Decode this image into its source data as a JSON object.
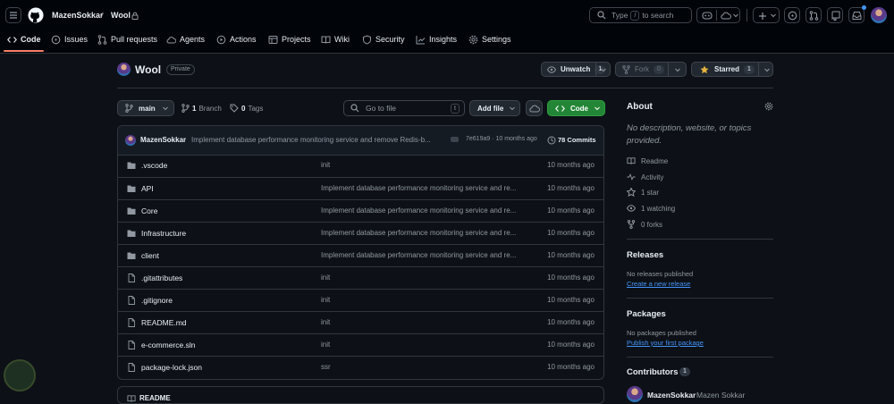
{
  "header": {
    "owner": "MazenSokkar",
    "separator": "/",
    "repo": "Wool",
    "search_placeholder_pre": "Type",
    "search_key": "/",
    "search_placeholder_post": "to search"
  },
  "nav": {
    "items": [
      {
        "label": "Code",
        "icon": "code-icon"
      },
      {
        "label": "Issues",
        "icon": "issue-icon"
      },
      {
        "label": "Pull requests",
        "icon": "pull-request-icon"
      },
      {
        "label": "Agents",
        "icon": "agents-icon"
      },
      {
        "label": "Actions",
        "icon": "play-icon"
      },
      {
        "label": "Projects",
        "icon": "table-icon"
      },
      {
        "label": "Wiki",
        "icon": "book-icon"
      },
      {
        "label": "Security",
        "icon": "shield-icon"
      },
      {
        "label": "Insights",
        "icon": "graph-icon"
      },
      {
        "label": "Settings",
        "icon": "gear-icon"
      }
    ]
  },
  "repo": {
    "name": "Wool",
    "visibility": "Private",
    "unwatch_label": "Unwatch",
    "unwatch_count": "1",
    "fork_label": "Fork",
    "fork_count": "0",
    "starred_label": "Starred",
    "star_count": "1"
  },
  "toolbar": {
    "branch": "main",
    "branch_count": "1",
    "branch_label": "Branch",
    "tag_count": "0",
    "tag_label": "Tags",
    "goto_placeholder": "Go to file",
    "goto_key": "t",
    "add_file": "Add file",
    "code_button": "Code"
  },
  "commit": {
    "author": "MazenSokkar",
    "message": "Implement database performance monitoring service and remove Redis-b...",
    "hash_time": "7e619a9 · 10 months ago",
    "commits": "78 Commits"
  },
  "files": [
    {
      "type": "folder",
      "name": ".vscode",
      "message": "init",
      "time": "10 months ago"
    },
    {
      "type": "folder",
      "name": "API",
      "message": "Implement database performance monitoring service and re...",
      "time": "10 months ago"
    },
    {
      "type": "folder",
      "name": "Core",
      "message": "Implement database performance monitoring service and re...",
      "time": "10 months ago"
    },
    {
      "type": "folder",
      "name": "Infrastructure",
      "message": "Implement database performance monitoring service and re...",
      "time": "10 months ago"
    },
    {
      "type": "folder",
      "name": "client",
      "message": "Implement database performance monitoring service and re...",
      "time": "10 months ago"
    },
    {
      "type": "file",
      "name": ".gitattributes",
      "message": "init",
      "time": "10 months ago"
    },
    {
      "type": "file",
      "name": ".gitignore",
      "message": "init",
      "time": "10 months ago"
    },
    {
      "type": "file",
      "name": "README.md",
      "message": "init",
      "time": "10 months ago"
    },
    {
      "type": "file",
      "name": "e-commerce.sln",
      "message": "init",
      "time": "10 months ago"
    },
    {
      "type": "file",
      "name": "package-lock.json",
      "message": "ssr",
      "time": "10 months ago"
    }
  ],
  "readme_tab": "README",
  "about": {
    "title": "About",
    "description": "No description, website, or topics provided.",
    "items": [
      {
        "icon": "book-icon",
        "label": "Readme"
      },
      {
        "icon": "pulse-icon",
        "label": "Activity"
      },
      {
        "icon": "star-icon",
        "label": "1 star"
      },
      {
        "icon": "eye-icon",
        "label": "1 watching"
      },
      {
        "icon": "fork-icon",
        "label": "0 forks"
      }
    ]
  },
  "releases": {
    "title": "Releases",
    "empty": "No releases published",
    "link": "Create a new release"
  },
  "packages": {
    "title": "Packages",
    "empty": "No packages published",
    "link": "Publish your first package"
  },
  "contributors": {
    "title": "Contributors",
    "count": "1",
    "user": "MazenSokkar",
    "fullname": "Mazen Sokkar"
  },
  "colors": {
    "background": "#0d1117",
    "header": "#010409",
    "accent_green": "#238636",
    "link": "#4493f8",
    "underline": "#f78166"
  }
}
